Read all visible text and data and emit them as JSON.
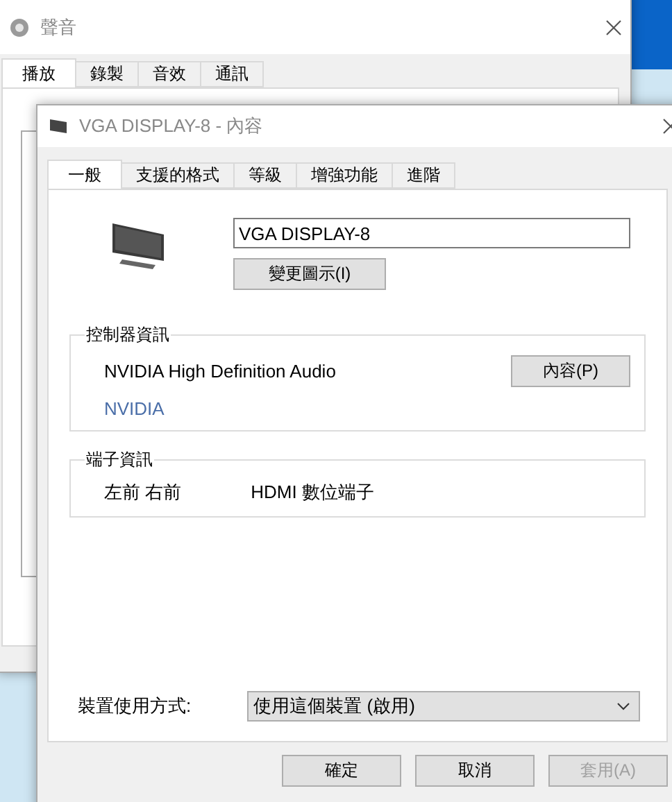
{
  "background_window": {
    "title": "聲音",
    "tabs": [
      {
        "label": "播放",
        "selected": true
      },
      {
        "label": "錄製",
        "selected": false
      },
      {
        "label": "音效",
        "selected": false
      },
      {
        "label": "通訊",
        "selected": false
      }
    ]
  },
  "dialog": {
    "title": "VGA DISPLAY-8 - 內容",
    "tabs": [
      {
        "label": "一般",
        "selected": true
      },
      {
        "label": "支援的格式",
        "selected": false
      },
      {
        "label": "等級",
        "selected": false
      },
      {
        "label": "增強功能",
        "selected": false
      },
      {
        "label": "進階",
        "selected": false
      }
    ],
    "device_name": "VGA DISPLAY-8",
    "change_icon_button": "變更圖示(I)",
    "controller_info": {
      "title": "控制器資訊",
      "name": "NVIDIA High Definition Audio",
      "vendor": "NVIDIA",
      "properties_button": "內容(P)"
    },
    "jack_info": {
      "title": "端子資訊",
      "channels": "左前 右前",
      "connector": "HDMI 數位端子"
    },
    "usage": {
      "label": "裝置使用方式:",
      "value": "使用這個裝置 (啟用)"
    },
    "buttons": [
      {
        "label": "確定",
        "disabled": false
      },
      {
        "label": "取消",
        "disabled": false
      },
      {
        "label": "套用(A)",
        "disabled": true
      }
    ]
  }
}
